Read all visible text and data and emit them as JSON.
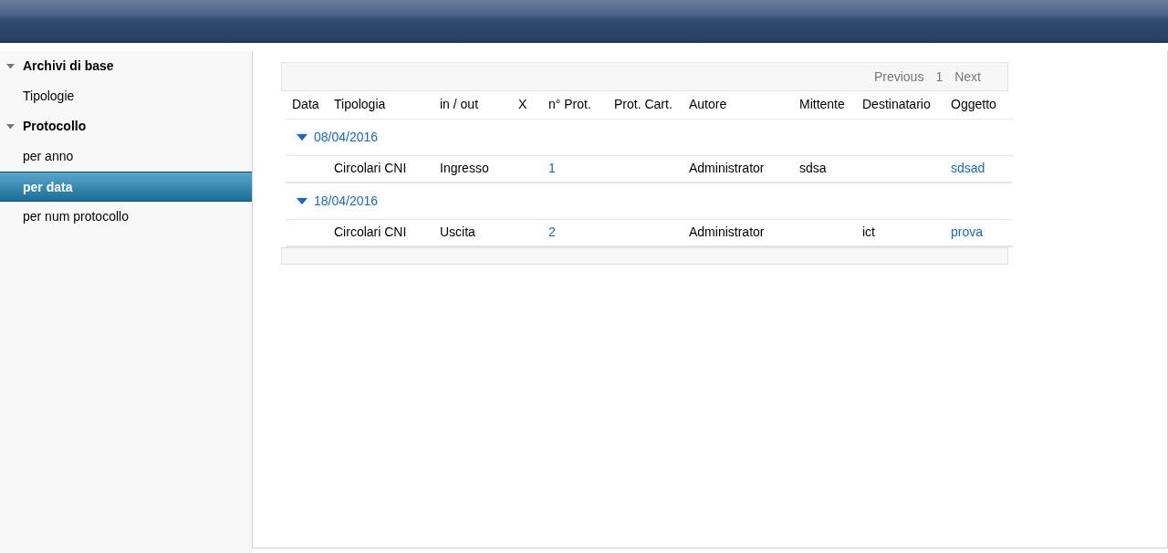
{
  "sidebar": {
    "groups": [
      {
        "label": "Archivi di base",
        "expanded": true,
        "items": [
          {
            "label": "Tipologie",
            "selected": false
          }
        ]
      },
      {
        "label": "Protocollo",
        "expanded": true,
        "items": [
          {
            "label": "per anno",
            "selected": false
          },
          {
            "label": "per data",
            "selected": true
          },
          {
            "label": "per num protocollo",
            "selected": false
          }
        ]
      }
    ]
  },
  "pagination": {
    "previous": "Previous",
    "pages": [
      {
        "label": "1",
        "selected": true
      }
    ],
    "next": "Next"
  },
  "table": {
    "columns": [
      "Data",
      "Tipologia",
      "in / out",
      "X",
      "n° Prot.",
      "Prot. Cart.",
      "Autore",
      "Mittente",
      "Destinatario",
      "Oggetto"
    ],
    "groups": [
      {
        "date": "08/04/2016",
        "expanded": true,
        "rows": [
          {
            "tipologia": {
              "text": "Circolari CNI",
              "link": false
            },
            "in_out": {
              "text": "Ingresso",
              "link": false
            },
            "n_prot": {
              "text": "1",
              "link": true
            },
            "autore": {
              "text": "Administrator",
              "link": false
            },
            "mittente": {
              "text": "sdsa",
              "link": false
            },
            "oggetto": {
              "text": "sdsad",
              "link": true
            }
          }
        ]
      },
      {
        "date": "18/04/2016",
        "expanded": true,
        "rows": [
          {
            "tipologia": {
              "text": "Circolari CNI",
              "link": false
            },
            "in_out": {
              "text": "Uscita",
              "link": false
            },
            "n_prot": {
              "text": "2",
              "link": true
            },
            "autore": {
              "text": "Administrator",
              "link": false
            },
            "destinatario": {
              "text": "ict",
              "link": false
            },
            "oggetto": {
              "text": "prova",
              "link": true
            }
          }
        ]
      }
    ]
  }
}
